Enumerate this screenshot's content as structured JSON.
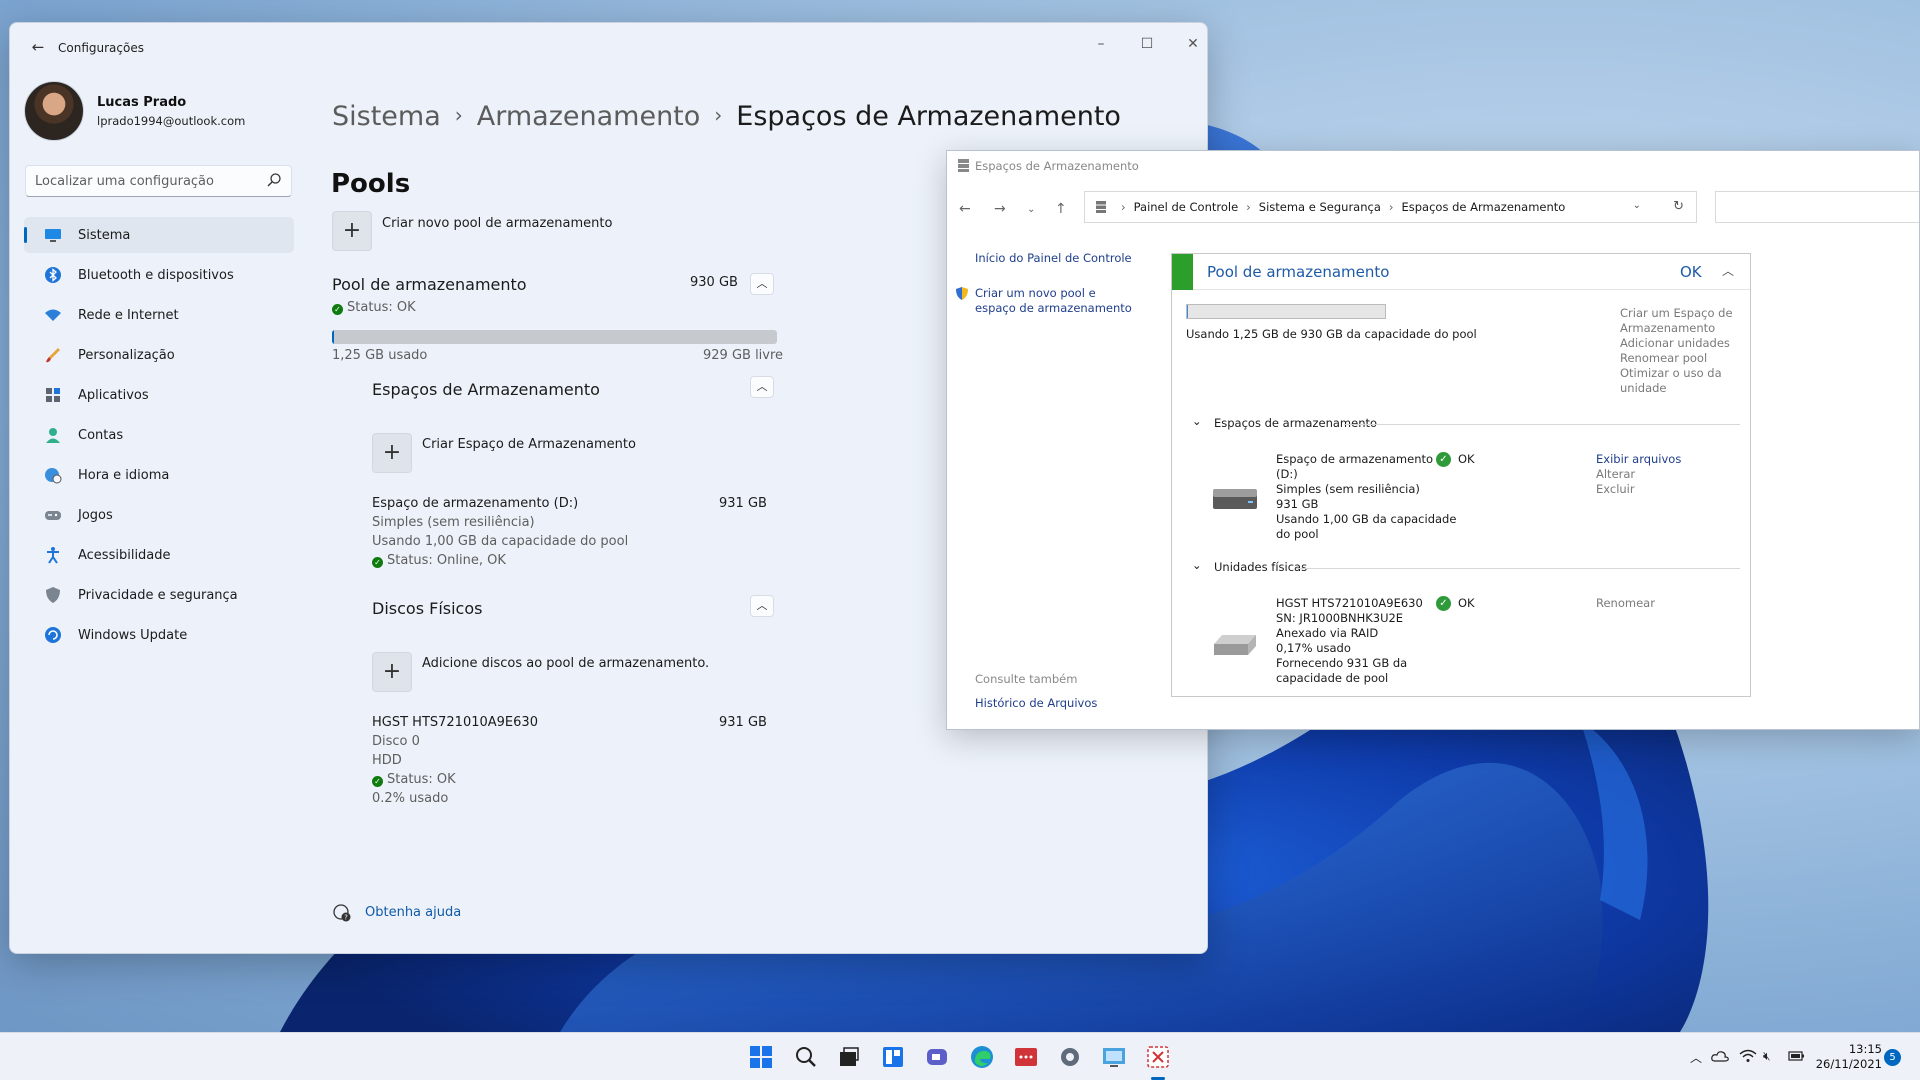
{
  "settings": {
    "app_title": "Configurações",
    "profile": {
      "name": "Lucas Prado",
      "email": "lprado1994@outlook.com"
    },
    "search_placeholder": "Localizar uma configuração",
    "nav": [
      {
        "label": "Sistema",
        "icon": "system-icon",
        "active": true
      },
      {
        "label": "Bluetooth e dispositivos",
        "icon": "bluetooth-icon"
      },
      {
        "label": "Rede e Internet",
        "icon": "wifi-icon"
      },
      {
        "label": "Personalização",
        "icon": "brush-icon"
      },
      {
        "label": "Aplicativos",
        "icon": "apps-icon"
      },
      {
        "label": "Contas",
        "icon": "person-icon"
      },
      {
        "label": "Hora e idioma",
        "icon": "globe-clock-icon"
      },
      {
        "label": "Jogos",
        "icon": "gamepad-icon"
      },
      {
        "label": "Acessibilidade",
        "icon": "accessibility-icon"
      },
      {
        "label": "Privacidade e segurança",
        "icon": "shield-icon"
      },
      {
        "label": "Windows Update",
        "icon": "update-icon"
      }
    ],
    "breadcrumb": [
      "Sistema",
      "Armazenamento",
      "Espaços de Armazenamento"
    ],
    "section_title": "Pools",
    "create_pool_label": "Criar novo pool de armazenamento",
    "pool": {
      "name": "Pool de armazenamento",
      "size": "930 GB",
      "status": "Status: OK",
      "used": "1,25 GB usado",
      "free": "929 GB livre",
      "used_fraction": 0.0013
    },
    "spaces": {
      "title": "Espaços de Armazenamento",
      "create_label": "Criar Espaço de Armazenamento",
      "item": {
        "name": "Espaço de armazenamento (D:)",
        "size": "931 GB",
        "resiliency": "Simples (sem resiliência)",
        "usage": "Usando 1,00 GB da capacidade do pool",
        "status": "Status: Online, OK"
      }
    },
    "disks": {
      "title": "Discos Físicos",
      "add_label": "Adicione discos ao pool de armazenamento.",
      "item": {
        "name": "HGST HTS721010A9E630",
        "size": "931 GB",
        "disk": "Disco 0",
        "type": "HDD",
        "status": "Status: OK",
        "usage": "0.2% usado"
      }
    },
    "help_label": "Obtenha ajuda"
  },
  "cpanel": {
    "title": "Espaços de Armazenamento",
    "address": [
      "Painel de Controle",
      "Sistema e Segurança",
      "Espaços de Armazenamento"
    ],
    "left_links": {
      "home": "Início do Painel de Controle",
      "create": "Criar um novo pool e espaço de armazenamento",
      "see_also": "Consulte também",
      "history": "Histórico de Arquivos"
    },
    "pool": {
      "title": "Pool de armazenamento",
      "status": "OK",
      "usage_text": "Usando 1,25 GB de 930 GB da capacidade do pool",
      "used_fraction": 0.0013,
      "actions": [
        "Criar um Espaço de",
        "Armazenamento",
        "Adicionar unidades",
        "Renomear pool",
        "Otimizar o uso da",
        "unidade"
      ]
    },
    "spaces_header": "Espaços de armazenamento",
    "space": {
      "lines": [
        "Espaço de armazenamento",
        "(D:)",
        "Simples (sem resiliência)",
        "931 GB",
        "Usando 1,00 GB da capacidade",
        "do pool"
      ],
      "status": "OK",
      "actions": [
        "Exibir arquivos",
        "Alterar",
        "Excluir"
      ]
    },
    "drives_header": "Unidades físicas",
    "drive": {
      "lines": [
        "HGST HTS721010A9E630",
        "SN: JR1000BNHK3U2E",
        "Anexado via RAID",
        "0,17% usado",
        "Fornecendo 931 GB da",
        "capacidade de pool"
      ],
      "status": "OK",
      "action": "Renomear"
    }
  },
  "taskbar": {
    "time": "13:15",
    "date": "26/11/2021",
    "notifications": "5"
  },
  "colors": {
    "accent": "#0067c0",
    "ok_green": "#0f7b0f",
    "pool_green": "#2c9e2c"
  }
}
